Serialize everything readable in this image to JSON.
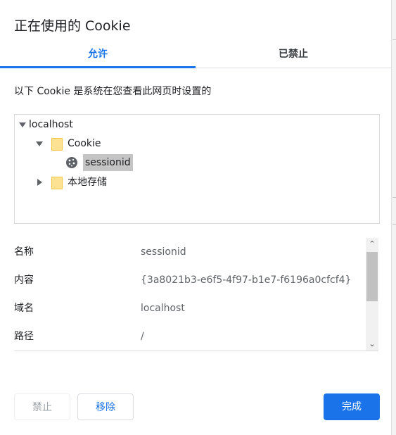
{
  "dialog": {
    "title": "正在使用的 Cookie",
    "tabs": [
      {
        "label": "允许",
        "active": true
      },
      {
        "label": "已禁止",
        "active": false
      }
    ],
    "description": "以下 Cookie 是系统在您查看此网页时设置的"
  },
  "tree": {
    "root": "localhost",
    "cookie_folder": "Cookie",
    "cookie_item": "sessionid",
    "storage_folder": "本地存储"
  },
  "details": [
    {
      "key": "名称",
      "value": "sessionid"
    },
    {
      "key": "内容",
      "value": "{3a8021b3-e6f5-4f97-b1e7-f6196a0cfcf4}"
    },
    {
      "key": "域名",
      "value": "localhost"
    },
    {
      "key": "路径",
      "value": "/"
    }
  ],
  "buttons": {
    "block": "禁止",
    "remove": "移除",
    "done": "完成"
  },
  "colors": {
    "accent": "#1a73e8",
    "selection": "#c4c4c4",
    "folder": "#fde293"
  }
}
